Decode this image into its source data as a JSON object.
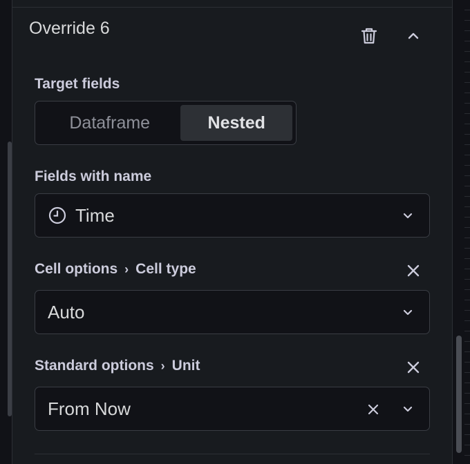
{
  "override": {
    "title": "Override 6"
  },
  "target_fields": {
    "label": "Target fields",
    "options": [
      "Dataframe",
      "Nested"
    ],
    "selected": "Nested"
  },
  "fields_with_name": {
    "label": "Fields with name",
    "value": "Time",
    "icon": "clock-icon"
  },
  "cell_type": {
    "path": [
      "Cell options",
      "Cell type"
    ],
    "separator": "›",
    "value": "Auto"
  },
  "unit": {
    "path": [
      "Standard options",
      "Unit"
    ],
    "separator": "›",
    "value": "From Now"
  },
  "colors": {
    "background": "#181b1f",
    "input_bg": "#111217",
    "border": "#3a3d44",
    "text": "#d8d9da",
    "muted": "#8e9099"
  }
}
